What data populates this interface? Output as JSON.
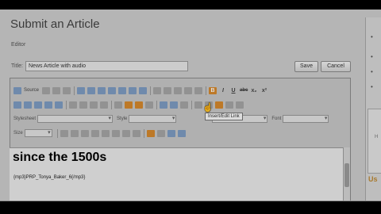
{
  "page": {
    "title": "Submit an Article",
    "editor_label": "Editor",
    "title_field": {
      "label": "Title:",
      "value": "News Article with audio"
    },
    "save_label": "Save",
    "cancel_label": "Cancel"
  },
  "editor": {
    "source_label": "Source",
    "bold_label": "B",
    "italic_label": "I",
    "underline_label": "U",
    "strike_label": "abc",
    "subscript_label": "x₂",
    "superscript_label": "x²",
    "stylesheet_label": "Stylesheet",
    "style_label": "Style",
    "font_label": "Font",
    "size_label": "Size",
    "tooltip": "Insert/Edit Link",
    "content_heading": "since the 1500s",
    "content_body": "{mp3}PRP_Tonya_Baker_6{/mp3}"
  },
  "sidebar": {
    "letter_he": "H",
    "letter_us": "Us"
  },
  "icons": {
    "cursor": "hand-pointer-icon",
    "grip": "scroll-grip-icon"
  }
}
